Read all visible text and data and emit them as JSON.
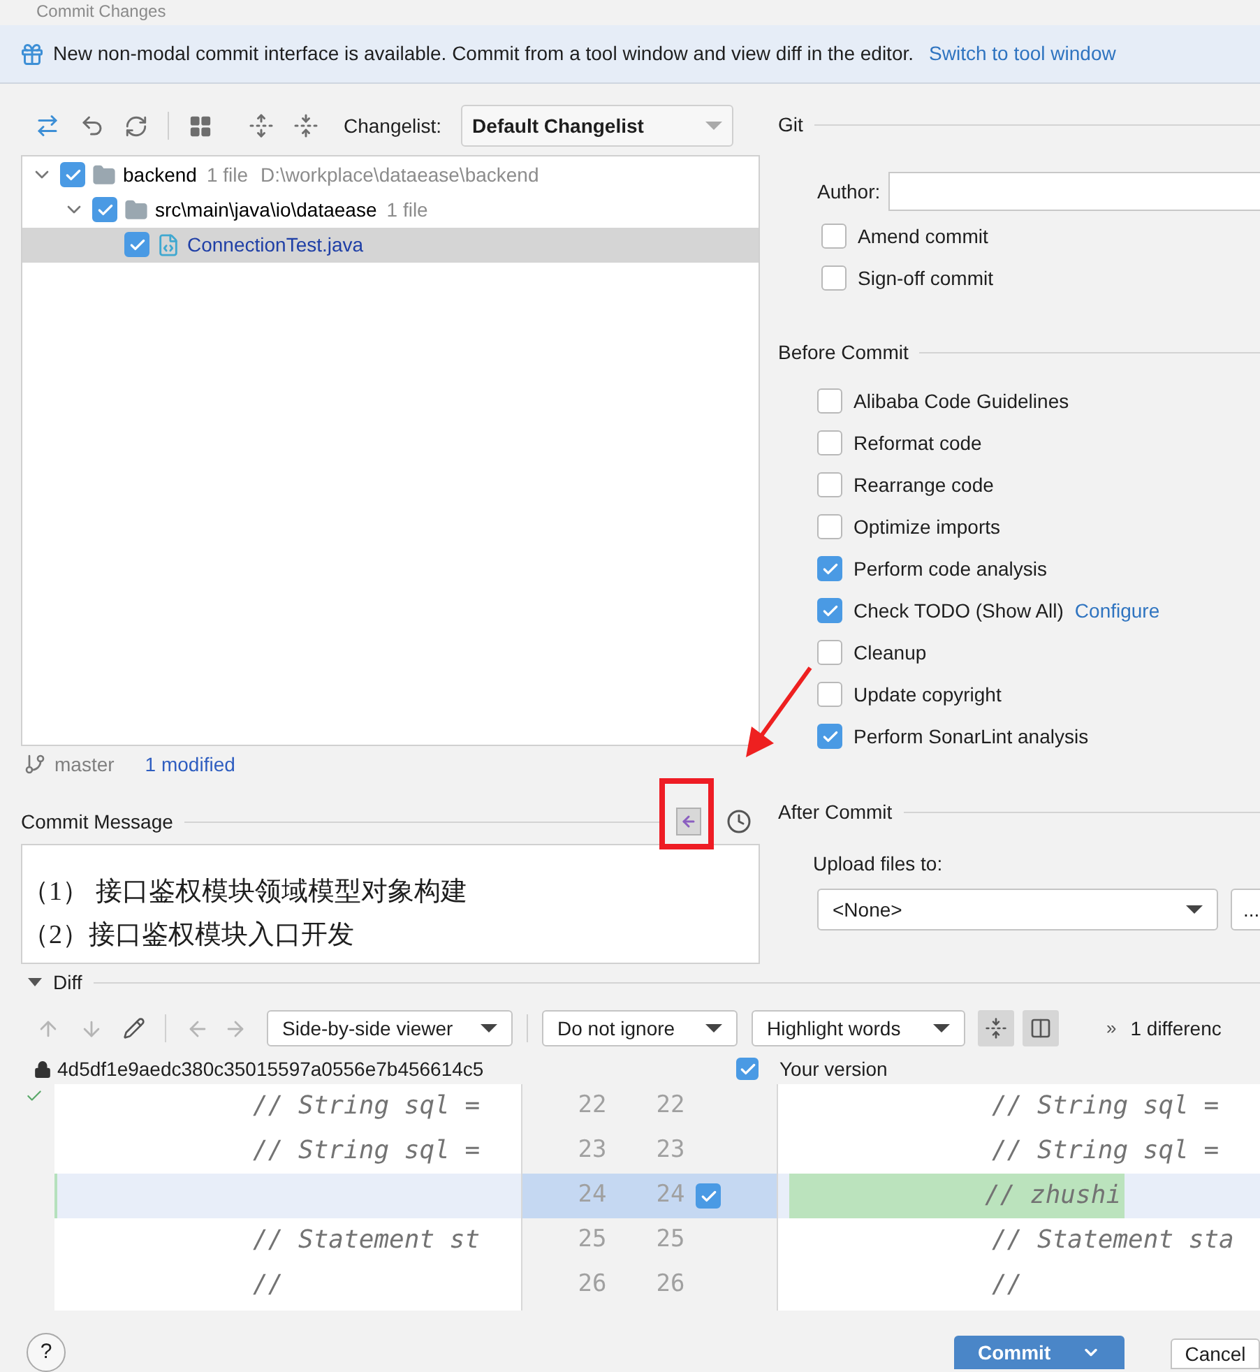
{
  "window": {
    "title": "Commit Changes"
  },
  "banner": {
    "text": "New non-modal commit interface is available. Commit from a tool window and view diff in the editor.",
    "link": "Switch to tool window"
  },
  "changelist": {
    "label": "Changelist:",
    "value": "Default Changelist"
  },
  "tree": [
    {
      "kind": "module",
      "label": "backend",
      "count": "1 file",
      "path": "D:\\workplace\\dataease\\backend",
      "checked": true,
      "expanded": true,
      "selected": false,
      "children": [
        {
          "kind": "folder",
          "label": "src\\main\\java\\io\\dataease",
          "count": "1 file",
          "checked": true,
          "expanded": true,
          "selected": false,
          "children": [
            {
              "kind": "file",
              "label": "ConnectionTest.java",
              "checked": true,
              "selected": true
            }
          ]
        }
      ]
    }
  ],
  "status": {
    "branch": "master",
    "modified": "1 modified"
  },
  "commit_message": {
    "label": "Commit Message",
    "lines": [
      "（1） 接口鉴权模块领域模型对象构建",
      "（2）接口鉴权模块入口开发"
    ]
  },
  "git": {
    "title": "Git",
    "author_label": "Author:",
    "options": [
      {
        "label": "Amend commit",
        "checked": false
      },
      {
        "label": "Sign-off commit",
        "checked": false
      }
    ]
  },
  "before_commit": {
    "title": "Before Commit",
    "options": [
      {
        "label": "Alibaba Code Guidelines",
        "checked": false
      },
      {
        "label": "Reformat code",
        "checked": false
      },
      {
        "label": "Rearrange code",
        "checked": false
      },
      {
        "label": "Optimize imports",
        "checked": false
      },
      {
        "label": "Perform code analysis",
        "checked": true
      },
      {
        "label": "Check TODO (Show All)",
        "checked": true,
        "link": "Configure"
      },
      {
        "label": "Cleanup",
        "checked": false
      },
      {
        "label": "Update copyright",
        "checked": false
      },
      {
        "label": "Perform SonarLint analysis",
        "checked": true
      }
    ]
  },
  "after_commit": {
    "title": "After Commit",
    "upload_label": "Upload files to:",
    "upload_value": "<None>",
    "more_button": "..."
  },
  "diff": {
    "title": "Diff",
    "expanded": true,
    "viewer": "Side-by-side viewer",
    "ignore": "Do not ignore",
    "highlight": "Highlight words",
    "more": "»",
    "differences": "1 differenc",
    "left_title": "4d5df1e9aedc380c35015597a0556e7b456614c5",
    "right_title": "Your version",
    "include_all": true,
    "rows": [
      {
        "kind": "same",
        "left_num": "22",
        "right_num": "22",
        "left": "// String sql =",
        "right": "// String sql ="
      },
      {
        "kind": "same",
        "left_num": "23",
        "right_num": "23",
        "left": "// String sql =",
        "right": "// String sql ="
      },
      {
        "kind": "added",
        "left_num": "24",
        "right_num": "24",
        "left": "",
        "right": "// zhushi",
        "checked": true
      },
      {
        "kind": "same",
        "left_num": "25",
        "right_num": "25",
        "left": "// Statement st",
        "right": "// Statement sta"
      },
      {
        "kind": "same",
        "left_num": "26",
        "right_num": "26",
        "left": "//",
        "right": "//"
      }
    ]
  },
  "footer": {
    "help": "?",
    "commit": "Commit",
    "cancel": "Cancel"
  }
}
